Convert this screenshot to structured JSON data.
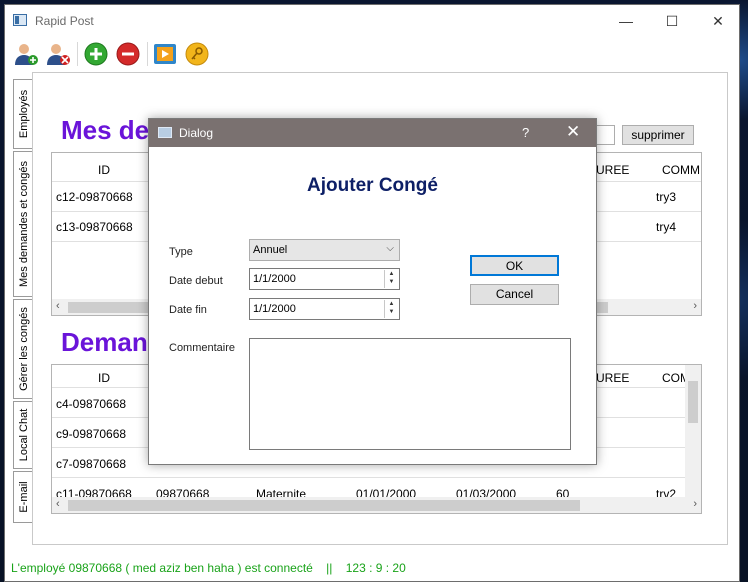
{
  "window": {
    "title": "Rapid Post",
    "minimize": "—",
    "maximize": "☐",
    "close": "✕"
  },
  "toolbar": {
    "add_user_icon": "add-user-icon",
    "remove_user_icon": "remove-user-icon",
    "add_icon": "add-icon",
    "remove_icon": "remove-icon",
    "play_icon": "play-icon",
    "key_icon": "key-icon"
  },
  "tabs": [
    "Employés",
    "Mes demandes et congés",
    "Gérer les congés",
    "Local Chat",
    "E-mail"
  ],
  "main": {
    "title_top": "Mes demandes et congés",
    "delete_button": "supprimer",
    "top_table": {
      "headers": [
        "ID",
        "UREE",
        "COMMI"
      ],
      "rows": [
        [
          "c12-09870668",
          "try3"
        ],
        [
          "c13-09870668",
          "try4"
        ]
      ]
    },
    "title_bottom": "Demandes",
    "bottom_table": {
      "headers": [
        "ID",
        "UREE",
        "COM"
      ],
      "rows": [
        [
          "c4-09870668"
        ],
        [
          "c9-09870668"
        ],
        [
          "c7-09870668"
        ],
        [
          "c11-09870668",
          "09870668",
          "Maternite",
          "01/01/2000",
          "01/03/2000",
          "60",
          "trv2"
        ]
      ]
    }
  },
  "dialog": {
    "title": "Dialog",
    "help": "?",
    "close": "✕",
    "heading": "Ajouter Congé",
    "type_label": "Type",
    "type_value": "Annuel",
    "start_label": "Date debut",
    "start_value": "1/1/2000",
    "end_label": "Date fin",
    "end_value": "1/1/2000",
    "comment_label": "Commentaire",
    "comment_value": "",
    "ok": "OK",
    "cancel": "Cancel"
  },
  "status": {
    "text": "L'employé 09870668 ( med aziz ben haha ) est connecté    ||    123 : 9 : 20"
  },
  "colors": {
    "title_purple": "#6a14d9",
    "dialog_heading": "#0d1f66",
    "status_green": "#1aa31a",
    "dialog_titlebar": "#7a7170"
  }
}
